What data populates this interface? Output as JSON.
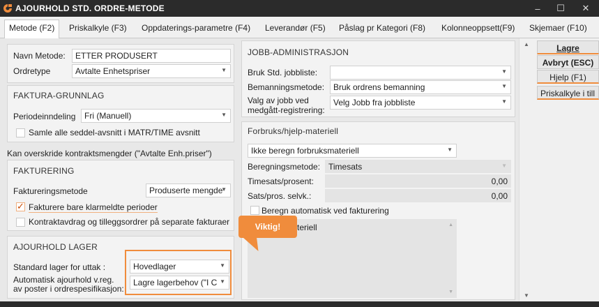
{
  "window": {
    "title": "AJOURHOLD STD. ORDRE-METODE",
    "minimize": "–",
    "maximize": "☐",
    "close": "✕"
  },
  "tabs": [
    {
      "label": "Metode (F2)",
      "active": true
    },
    {
      "label": "Priskalkyle (F3)"
    },
    {
      "label": "Oppdaterings-parametre (F4)"
    },
    {
      "label": "Leverandør (F5)"
    },
    {
      "label": "Påslag pr Kategori (F8)"
    },
    {
      "label": "Kolonneoppsett(F9)"
    },
    {
      "label": "Skjemaer (F10)"
    }
  ],
  "left": {
    "navn_label": "Navn Metode:",
    "navn_value": "ETTER PRODUSERT",
    "ordretype_label": "Ordretype",
    "ordretype_value": "Avtalte Enhetspriser",
    "faktura_grunnlag": {
      "header": "FAKTURA-GRUNNLAG",
      "periode_label": "Periodeinndeling",
      "periode_value": "Fri (Manuell)",
      "samle_label": "Samle alle seddel-avsnitt i MATR/TIME avsnitt"
    },
    "kan_overskride": "Kan overskride kontraktsmengder (\"Avtalte Enh.priser\")",
    "fakturering": {
      "header": "FAKTURERING",
      "metode_label": "Faktureringsmetode",
      "metode_value": "Produserte mengde",
      "klarmeldte_label": "Fakturere bare klarmeldte perioder",
      "klarmeldte_check": "✓",
      "kontraktavdrag_label": "Kontraktavdrag og tilleggsordrer på separate fakturaer"
    },
    "ajourhold_lager": {
      "header": "AJOURHOLD LAGER",
      "standard_label": "Standard lager for uttak :",
      "standard_value": "Hovedlager",
      "auto_label_1": "Automatisk ajourhold v.reg.",
      "auto_label_2": "av poster i ordrespesifikasjon:",
      "auto_value": "Lagre lagerbehov (\"I C"
    }
  },
  "jobb": {
    "header": "JOBB-ADMINISTRASJON",
    "bruk_label": "Bruk Std. jobbliste:",
    "bruk_value": "",
    "bemanning_label": "Bemanningsmetode:",
    "bemanning_value": "Bruk ordrens bemanning",
    "valg_label_1": "Valg av jobb ved",
    "valg_label_2": "medgått-registrering:",
    "valg_value": "Velg Jobb fra jobbliste"
  },
  "forbruk": {
    "header": "Forbruks/hjelp-materiell",
    "mode_value": "Ikke beregn forbruksmateriell",
    "beregning_label": "Beregningsmetode:",
    "beregning_value": "Timesats",
    "timesats_label": "Timesats/prosent:",
    "timesats_value": "0,00",
    "sats_label": "Sats/pros. selvk.:",
    "sats_value": "0,00",
    "auto_label": "Beregn automatisk ved fakturering",
    "list_partial": "teriell"
  },
  "callout": {
    "label": "Viktig!"
  },
  "buttons": {
    "lagre": "Lagre",
    "avbryt": "Avbryt (ESC)",
    "hjelp": "Hjelp (F1)",
    "priskalkyle": "Priskalkyle i till"
  },
  "colors": {
    "accent": "#f08c3c",
    "titlebar": "#2b2b2b"
  }
}
